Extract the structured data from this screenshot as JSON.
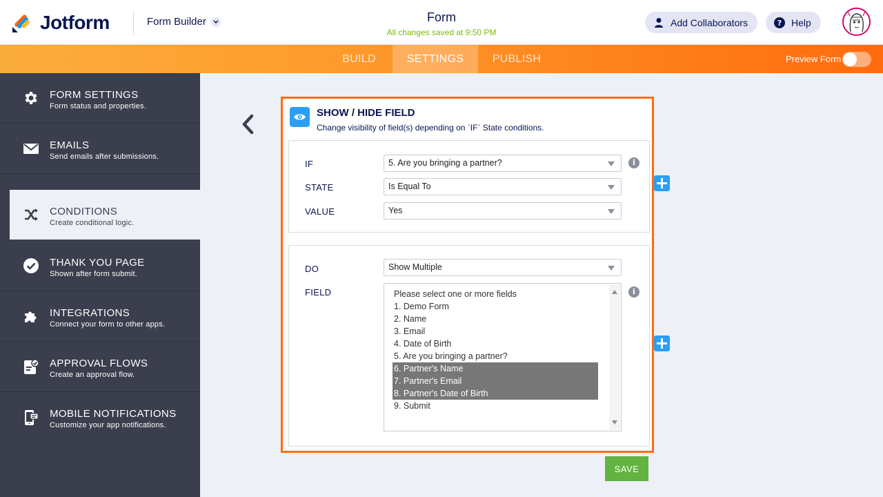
{
  "header": {
    "logo_text": "Jotform",
    "builder_label": "Form Builder",
    "form_title": "Form",
    "saved_status": "All changes saved at 9:50 PM",
    "collaborators_label": "Add Collaborators",
    "help_label": "Help"
  },
  "nav": {
    "tabs": [
      {
        "label": "BUILD",
        "active": false
      },
      {
        "label": "SETTINGS",
        "active": true
      },
      {
        "label": "PUBLISH",
        "active": false
      }
    ],
    "preview_label": "Preview Form",
    "preview_on": false
  },
  "sidebar": {
    "items": [
      {
        "title": "FORM SETTINGS",
        "subtitle": "Form status and properties.",
        "icon": "gear-icon"
      },
      {
        "title": "EMAILS",
        "subtitle": "Send emails after submissions.",
        "icon": "envelope-icon"
      },
      {
        "title": "CONDITIONS",
        "subtitle": "Create conditional logic.",
        "icon": "shuffle-icon",
        "active": true
      },
      {
        "title": "THANK YOU PAGE",
        "subtitle": "Shown after form submit.",
        "icon": "check-circle-icon"
      },
      {
        "title": "INTEGRATIONS",
        "subtitle": "Connect your form to other apps.",
        "icon": "puzzle-icon"
      },
      {
        "title": "APPROVAL FLOWS",
        "subtitle": "Create an approval flow.",
        "icon": "approval-icon"
      },
      {
        "title": "MOBILE NOTIFICATIONS",
        "subtitle": "Customize your app notifications.",
        "icon": "mobile-icon"
      }
    ]
  },
  "condition": {
    "title": "SHOW / HIDE FIELD",
    "subtitle": "Change visibility of field(s) depending on `IF` State conditions.",
    "if_label": "IF",
    "if_value": "5. Are you bringing a partner?",
    "state_label": "STATE",
    "state_value": "Is Equal To",
    "value_label": "VALUE",
    "value_value": "Yes",
    "do_label": "DO",
    "do_value": "Show Multiple",
    "field_label": "FIELD",
    "field_options": [
      {
        "label": "Please select one or more fields",
        "selected": false
      },
      {
        "label": "1. Demo Form",
        "selected": false
      },
      {
        "label": "2. Name",
        "selected": false
      },
      {
        "label": "3. Email",
        "selected": false
      },
      {
        "label": "4. Date of Birth",
        "selected": false
      },
      {
        "label": "5. Are you bringing a partner?",
        "selected": false
      },
      {
        "label": "6. Partner's Name",
        "selected": true
      },
      {
        "label": "7. Partner's Email",
        "selected": true
      },
      {
        "label": "8. Partner's Date of Birth",
        "selected": true
      },
      {
        "label": "9. Submit",
        "selected": false
      }
    ]
  },
  "save_label": "SAVE",
  "colors": {
    "accent_orange": "#ff6b0e",
    "sidebar_bg": "#3a3e4d",
    "primary_blue": "#2b9ef5",
    "save_green": "#63b340",
    "saved_text": "#78bb07"
  }
}
